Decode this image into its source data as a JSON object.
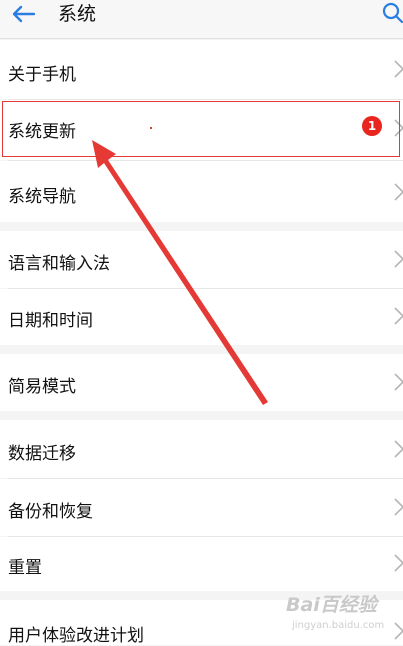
{
  "header": {
    "title": "系统"
  },
  "settings": [
    {
      "id": "about",
      "label": "关于手机"
    },
    {
      "id": "update",
      "label": "系统更新",
      "badge": "1"
    },
    {
      "id": "navigation",
      "label": "系统导航"
    },
    {
      "id": "language",
      "label": "语言和输入法"
    },
    {
      "id": "datetime",
      "label": "日期和时间"
    },
    {
      "id": "simple",
      "label": "简易模式"
    },
    {
      "id": "migration",
      "label": "数据迁移"
    },
    {
      "id": "backup",
      "label": "备份和恢复"
    },
    {
      "id": "reset",
      "label": "重置"
    },
    {
      "id": "experience",
      "label": "用户体验改进计划"
    }
  ],
  "icons": {
    "back": "back-arrow-icon",
    "search": "search-icon",
    "chevron": "chevron-right-icon"
  },
  "colors": {
    "accent": "#2a7de1",
    "highlight": "#e53935",
    "badge": "#e8251f",
    "background": "#f4f4f4"
  },
  "watermark": {
    "text": "Bai百经验",
    "subtext": "jingyan.baidu.com"
  }
}
